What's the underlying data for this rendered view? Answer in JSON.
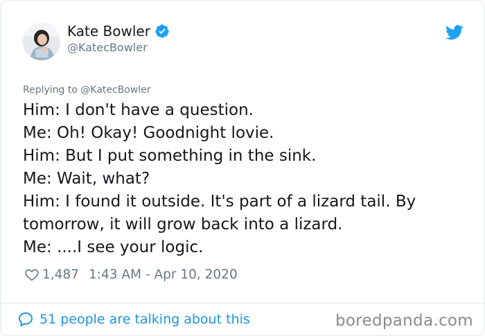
{
  "author": {
    "name": "Kate Bowler",
    "handle": "@KatecBowler"
  },
  "tweet": {
    "replying_to": "Replying to @KatecBowler",
    "lines": [
      "Him: I don't have a question.",
      "Me: Oh! Okay! Goodnight lovie.",
      "Him: But I put something in the sink.",
      "Me: Wait, what?",
      "Him: I found it outside. It's part of a lizard tail. By",
      "tomorrow, it will grow back into a lizard.",
      "Me: ....I see your logic."
    ],
    "likes": "1,487",
    "timestamp": "1:43 AM - Apr 10, 2020"
  },
  "footer": {
    "talking": "51 people are talking about this",
    "watermark": "boredpanda.com"
  },
  "icons": {
    "verified": "verified-badge-icon",
    "bird": "twitter-bird-icon",
    "heart": "heart-icon",
    "bubble": "reply-bubble-icon"
  },
  "colors": {
    "accent": "#1da1f2",
    "link": "#1b95e0",
    "muted": "#657786",
    "text": "#14171a"
  }
}
